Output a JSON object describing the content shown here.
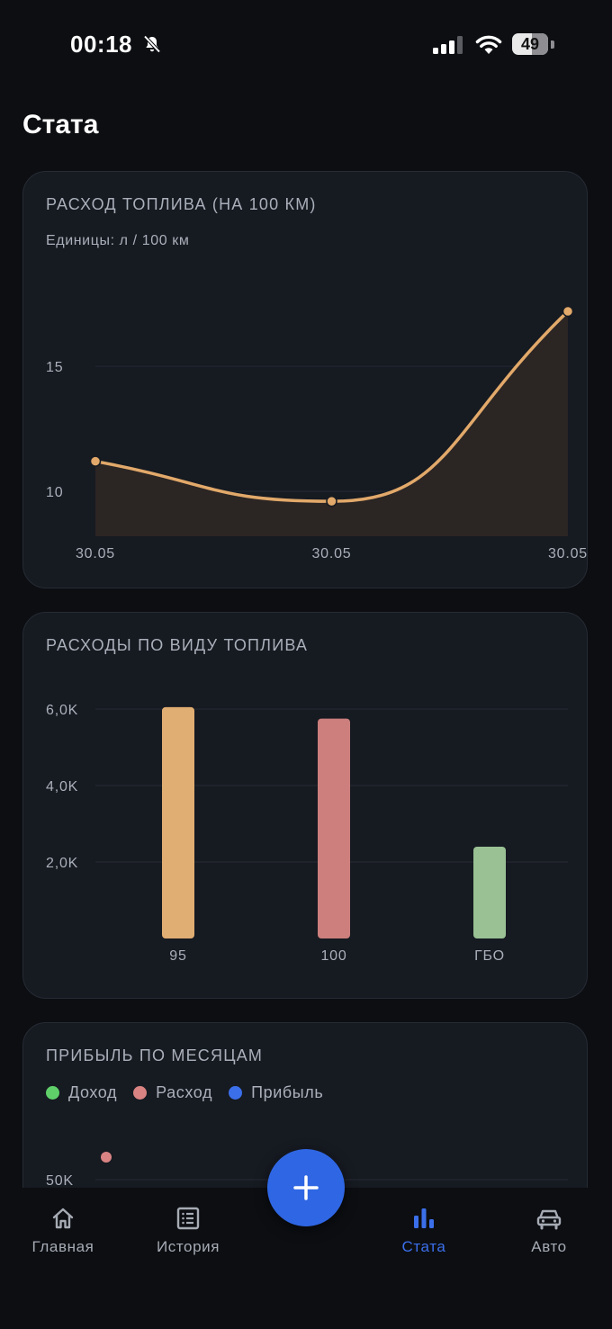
{
  "status_bar": {
    "time": "00:18",
    "battery": "49"
  },
  "page": {
    "title": "Стата"
  },
  "fuel_consumption": {
    "title": "РАСХОД ТОПЛИВА (НА 100 КМ)",
    "units": "Единицы: л / 100 км"
  },
  "fuel_expenses": {
    "title": "РАСХОДЫ ПО ВИДУ ТОПЛИВА"
  },
  "monthly_profit": {
    "title": "ПРИБЫЛЬ ПО МЕСЯЦАМ",
    "legend": [
      "Доход",
      "Расход",
      "Прибыль"
    ]
  },
  "chart_data": [
    {
      "type": "area",
      "title": "РАСХОД ТОПЛИВА (НА 100 КМ)",
      "subtitle": "Единицы: л / 100 км",
      "x": [
        "30.05",
        "30.05",
        "30.05"
      ],
      "values": [
        11.2,
        9.6,
        17.2
      ],
      "yticks": [
        10,
        15
      ],
      "ylim": [
        8.2,
        19
      ],
      "color": "#e2a96a",
      "grid": true
    },
    {
      "type": "bar",
      "title": "РАСХОДЫ ПО ВИДУ ТОПЛИВА",
      "categories": [
        "95",
        "100",
        "ГБО"
      ],
      "values": [
        6050,
        5750,
        2400
      ],
      "colors": [
        "#e0ad72",
        "#cc7f7d",
        "#99c194"
      ],
      "yticks": [
        "2,0K",
        "4,0K",
        "6,0K"
      ],
      "ytick_values": [
        2000,
        4000,
        6000
      ],
      "ylim": [
        0,
        6000
      ],
      "grid": true
    },
    {
      "type": "scatter",
      "title": "ПРИБЫЛЬ ПО МЕСЯЦАМ",
      "series": [
        {
          "name": "Доход",
          "color": "#5fcf6a",
          "values": []
        },
        {
          "name": "Расход",
          "color": "#d98383",
          "values": [
            60000
          ]
        },
        {
          "name": "Прибыль",
          "color": "#3b6fea",
          "values": []
        }
      ],
      "yticks": [
        "50K"
      ],
      "ytick_values": [
        50000
      ]
    }
  ],
  "tabbar": {
    "tabs": [
      {
        "label": "Главная",
        "icon": "home-icon"
      },
      {
        "label": "История",
        "icon": "list-icon"
      },
      {
        "label": "Стата",
        "icon": "bar-chart-icon",
        "active": true
      },
      {
        "label": "Авто",
        "icon": "car-icon"
      }
    ],
    "fab_icon": "plus-icon"
  },
  "colors": {
    "accent": "#2f66e3",
    "background": "#0c0e12",
    "card": "#161a21"
  }
}
